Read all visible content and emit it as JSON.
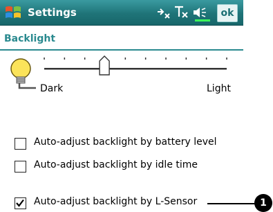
{
  "titlebar": {
    "title": "Settings",
    "ok_label": "ok",
    "icons": [
      "windows-flag-icon",
      "network-icon",
      "signal-off-icon",
      "speaker-icon"
    ],
    "accent": "#1f7478"
  },
  "page": {
    "heading": "Backlight",
    "heading_color": "#2a8a8f"
  },
  "brightness": {
    "min_label": "Dark",
    "max_label": "Light",
    "ticks": 10,
    "level": 0.33
  },
  "options": [
    {
      "label": "Auto-adjust backlight by battery level",
      "checked": false
    },
    {
      "label": "Auto-adjust backlight by idle time",
      "checked": false
    },
    {
      "label": "Auto-adjust backlight by L-Sensor",
      "checked": true
    }
  ],
  "callout": {
    "marker": "1"
  }
}
